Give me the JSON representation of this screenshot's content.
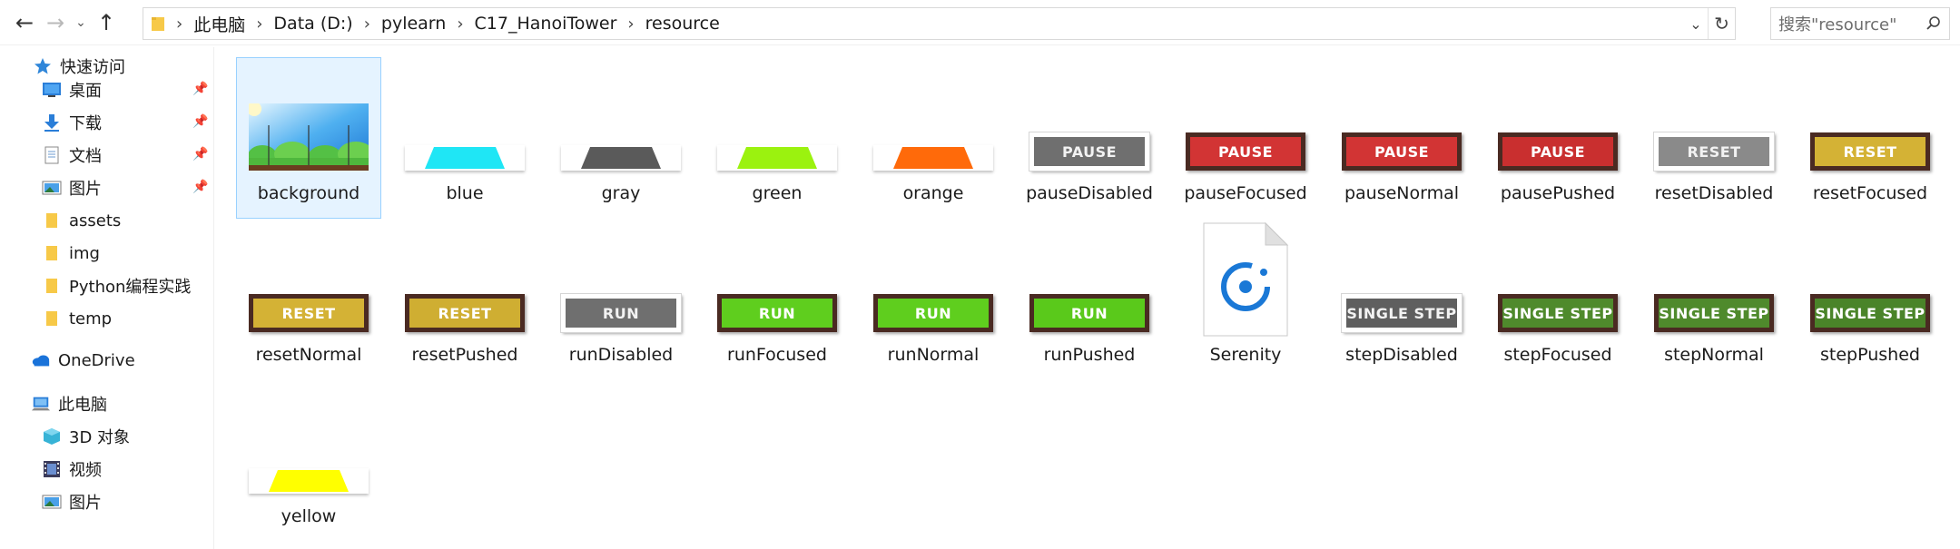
{
  "nav": {
    "back": "←",
    "forward": "→",
    "dropdown": "⌄",
    "up": "↑"
  },
  "address": {
    "breadcrumbs": [
      "此电脑",
      "Data (D:)",
      "pylearn",
      "C17_HanoiTower",
      "resource"
    ],
    "separator": "›",
    "dropdown": "⌄",
    "refresh": "↻"
  },
  "search": {
    "placeholder": "搜索\"resource\""
  },
  "sidebar": {
    "quick_access": "快速访问",
    "pinned": [
      {
        "label": "桌面",
        "icon": "desktop-icon"
      },
      {
        "label": "下载",
        "icon": "download-icon"
      },
      {
        "label": "文档",
        "icon": "document-icon"
      },
      {
        "label": "图片",
        "icon": "pictures-icon"
      }
    ],
    "folders": [
      {
        "label": "assets",
        "icon": "folder-icon"
      },
      {
        "label": "img",
        "icon": "folder-icon"
      },
      {
        "label": "Python编程实践",
        "icon": "folder-icon"
      },
      {
        "label": "temp",
        "icon": "folder-icon"
      }
    ],
    "onedrive": "OneDrive",
    "this_pc": "此电脑",
    "pc_items": [
      {
        "label": "3D 对象",
        "icon": "3d-objects-icon"
      },
      {
        "label": "视频",
        "icon": "videos-icon"
      },
      {
        "label": "图片",
        "icon": "pictures-icon"
      }
    ]
  },
  "files": [
    {
      "name": "background",
      "kind": "landscape",
      "selected": true
    },
    {
      "name": "blue",
      "kind": "trapezoid",
      "color": "#1fe6f5"
    },
    {
      "name": "gray",
      "kind": "trapezoid",
      "color": "#5a5a5a"
    },
    {
      "name": "green",
      "kind": "trapezoid",
      "color": "#9bf20f"
    },
    {
      "name": "orange",
      "kind": "trapezoid",
      "color": "#ff6a0a"
    },
    {
      "name": "pauseDisabled",
      "kind": "button",
      "text": "PAUSE",
      "fill": "#6f6f6f",
      "disabled": true
    },
    {
      "name": "pauseFocused",
      "kind": "button",
      "text": "PAUSE",
      "fill": "#d23434"
    },
    {
      "name": "pauseNormal",
      "kind": "button",
      "text": "PAUSE",
      "fill": "#d23434"
    },
    {
      "name": "pausePushed",
      "kind": "button",
      "text": "PAUSE",
      "fill": "#c92f2f"
    },
    {
      "name": "resetDisabled",
      "kind": "button",
      "text": "RESET",
      "fill": "#8a8a8a",
      "disabled": true
    },
    {
      "name": "resetFocused",
      "kind": "button",
      "text": "RESET",
      "fill": "#d4b235"
    },
    {
      "name": "resetNormal",
      "kind": "button",
      "text": "RESET",
      "fill": "#d4b235"
    },
    {
      "name": "resetPushed",
      "kind": "button",
      "text": "RESET",
      "fill": "#cfae32"
    },
    {
      "name": "runDisabled",
      "kind": "button",
      "text": "RUN",
      "fill": "#6f6f6f",
      "disabled": true
    },
    {
      "name": "runFocused",
      "kind": "button",
      "text": "RUN",
      "fill": "#5fce1e"
    },
    {
      "name": "runNormal",
      "kind": "button",
      "text": "RUN",
      "fill": "#5fce1e"
    },
    {
      "name": "runPushed",
      "kind": "button",
      "text": "RUN",
      "fill": "#5ac91b"
    },
    {
      "name": "Serenity",
      "kind": "document"
    },
    {
      "name": "stepDisabled",
      "kind": "button",
      "text": "SINGLE STEP",
      "fill": "#5f5f5f",
      "disabled": true
    },
    {
      "name": "stepFocused",
      "kind": "button",
      "text": "SINGLE STEP",
      "fill": "#4f8a2c"
    },
    {
      "name": "stepNormal",
      "kind": "button",
      "text": "SINGLE STEP",
      "fill": "#4f8a2c"
    },
    {
      "name": "stepPushed",
      "kind": "button",
      "text": "SINGLE STEP",
      "fill": "#4a8429"
    },
    {
      "name": "yellow",
      "kind": "trapezoid",
      "color": "#ffff00"
    }
  ]
}
